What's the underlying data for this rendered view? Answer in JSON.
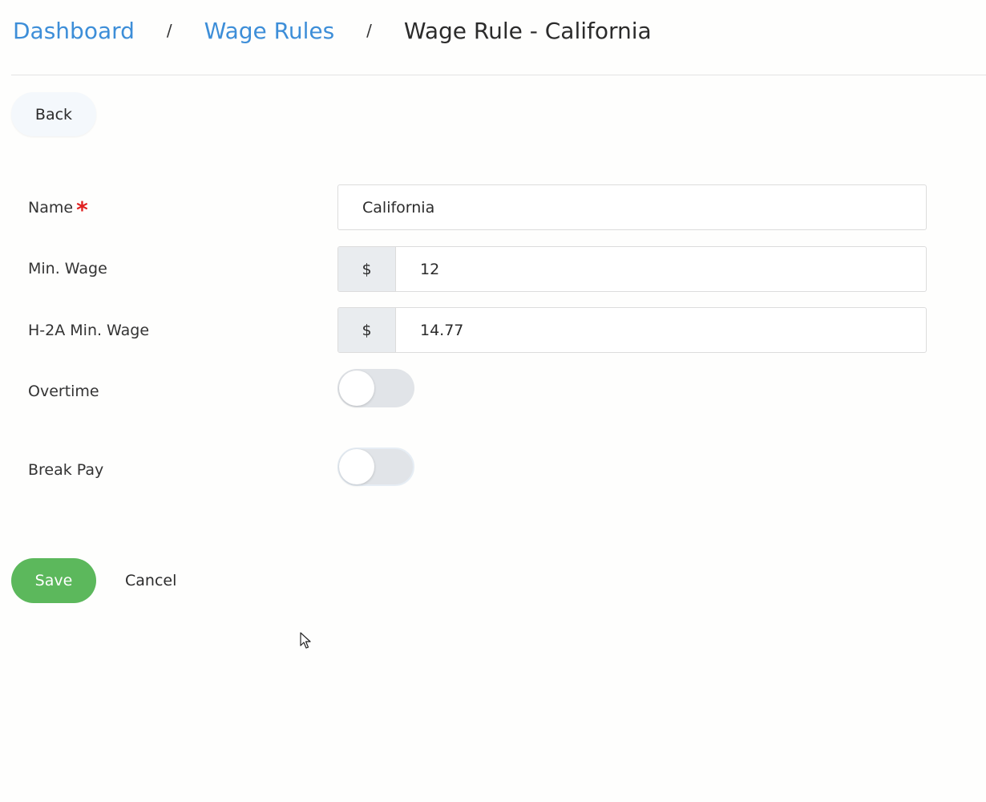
{
  "breadcrumb": {
    "items": [
      {
        "label": "Dashboard"
      },
      {
        "label": "Wage Rules"
      }
    ],
    "separator": "/",
    "current": "Wage Rule - California"
  },
  "actions": {
    "back_label": "Back",
    "save_label": "Save",
    "cancel_label": "Cancel"
  },
  "form": {
    "name": {
      "label": "Name",
      "required_marker": "*",
      "value": "California"
    },
    "min_wage": {
      "label": "Min. Wage",
      "prefix": "$",
      "value": "12"
    },
    "h2a_min_wage": {
      "label": "H-2A Min. Wage",
      "prefix": "$",
      "value": "14.77"
    },
    "overtime": {
      "label": "Overtime",
      "enabled": false
    },
    "break_pay": {
      "label": "Break Pay",
      "enabled": false
    }
  },
  "colors": {
    "link": "#3d8ed8",
    "save_button": "#5cb85c",
    "required": "#e02020",
    "toggle_off": "#e1e4e8"
  },
  "icons": {
    "cursor": "mouse-pointer-icon"
  }
}
